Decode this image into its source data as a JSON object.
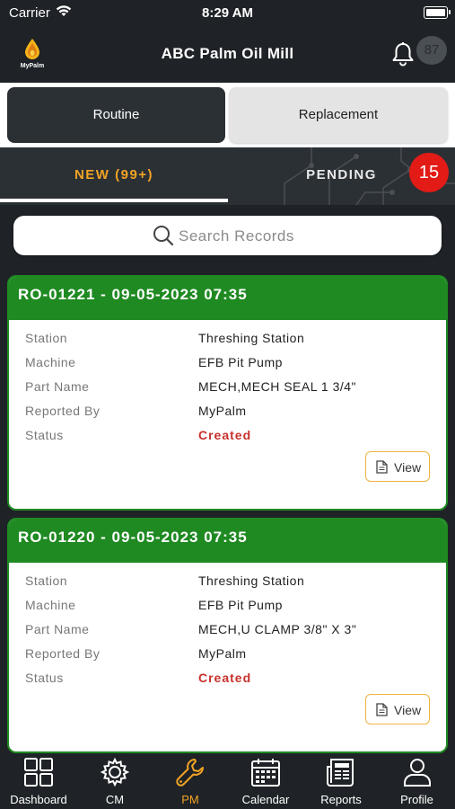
{
  "status_bar": {
    "carrier": "Carrier",
    "time": "8:29 AM"
  },
  "header": {
    "title": "ABC Palm Oil Mill",
    "logo_text": "MyPalm",
    "notification_count": "87"
  },
  "segments": {
    "routine": "Routine",
    "replacement": "Replacement",
    "selected": "Routine"
  },
  "tabs": {
    "new_label": "NEW (99+)",
    "pending_label": "PENDING",
    "pending_badge": "15",
    "active": "NEW (99+)"
  },
  "search": {
    "placeholder": "Search Records"
  },
  "records": [
    {
      "title": "RO-01221 - 09-05-2023 07:35",
      "fields": [
        {
          "label": "Station",
          "value": "Threshing Station"
        },
        {
          "label": "Machine",
          "value": "EFB Pit Pump"
        },
        {
          "label": "Part Name",
          "value": "MECH,MECH SEAL 1 3/4\""
        },
        {
          "label": "Reported By",
          "value": "MyPalm"
        },
        {
          "label": "Status",
          "value": "Created"
        }
      ],
      "action": "View"
    },
    {
      "title": "RO-01220 - 09-05-2023 07:35",
      "fields": [
        {
          "label": "Station",
          "value": "Threshing Station"
        },
        {
          "label": "Machine",
          "value": "EFB Pit Pump"
        },
        {
          "label": "Part Name",
          "value": "MECH,U CLAMP 3/8\" X 3\""
        },
        {
          "label": "Reported By",
          "value": "MyPalm"
        },
        {
          "label": "Status",
          "value": "Created"
        }
      ],
      "action": "View"
    }
  ],
  "bottom_nav": {
    "active": "PM",
    "items": [
      {
        "label": "Dashboard",
        "icon": "grid-icon"
      },
      {
        "label": "CM",
        "icon": "gear-icon"
      },
      {
        "label": "PM",
        "icon": "wrench-icon"
      },
      {
        "label": "Calendar",
        "icon": "calendar-icon"
      },
      {
        "label": "Reports",
        "icon": "newspaper-icon"
      },
      {
        "label": "Profile",
        "icon": "person-icon"
      }
    ]
  },
  "colors": {
    "accent": "#f2a324",
    "card_header": "#1f8a22",
    "status_created": "#c8312c",
    "badge_red": "#e31b17",
    "dark_bg": "#1f2327"
  }
}
